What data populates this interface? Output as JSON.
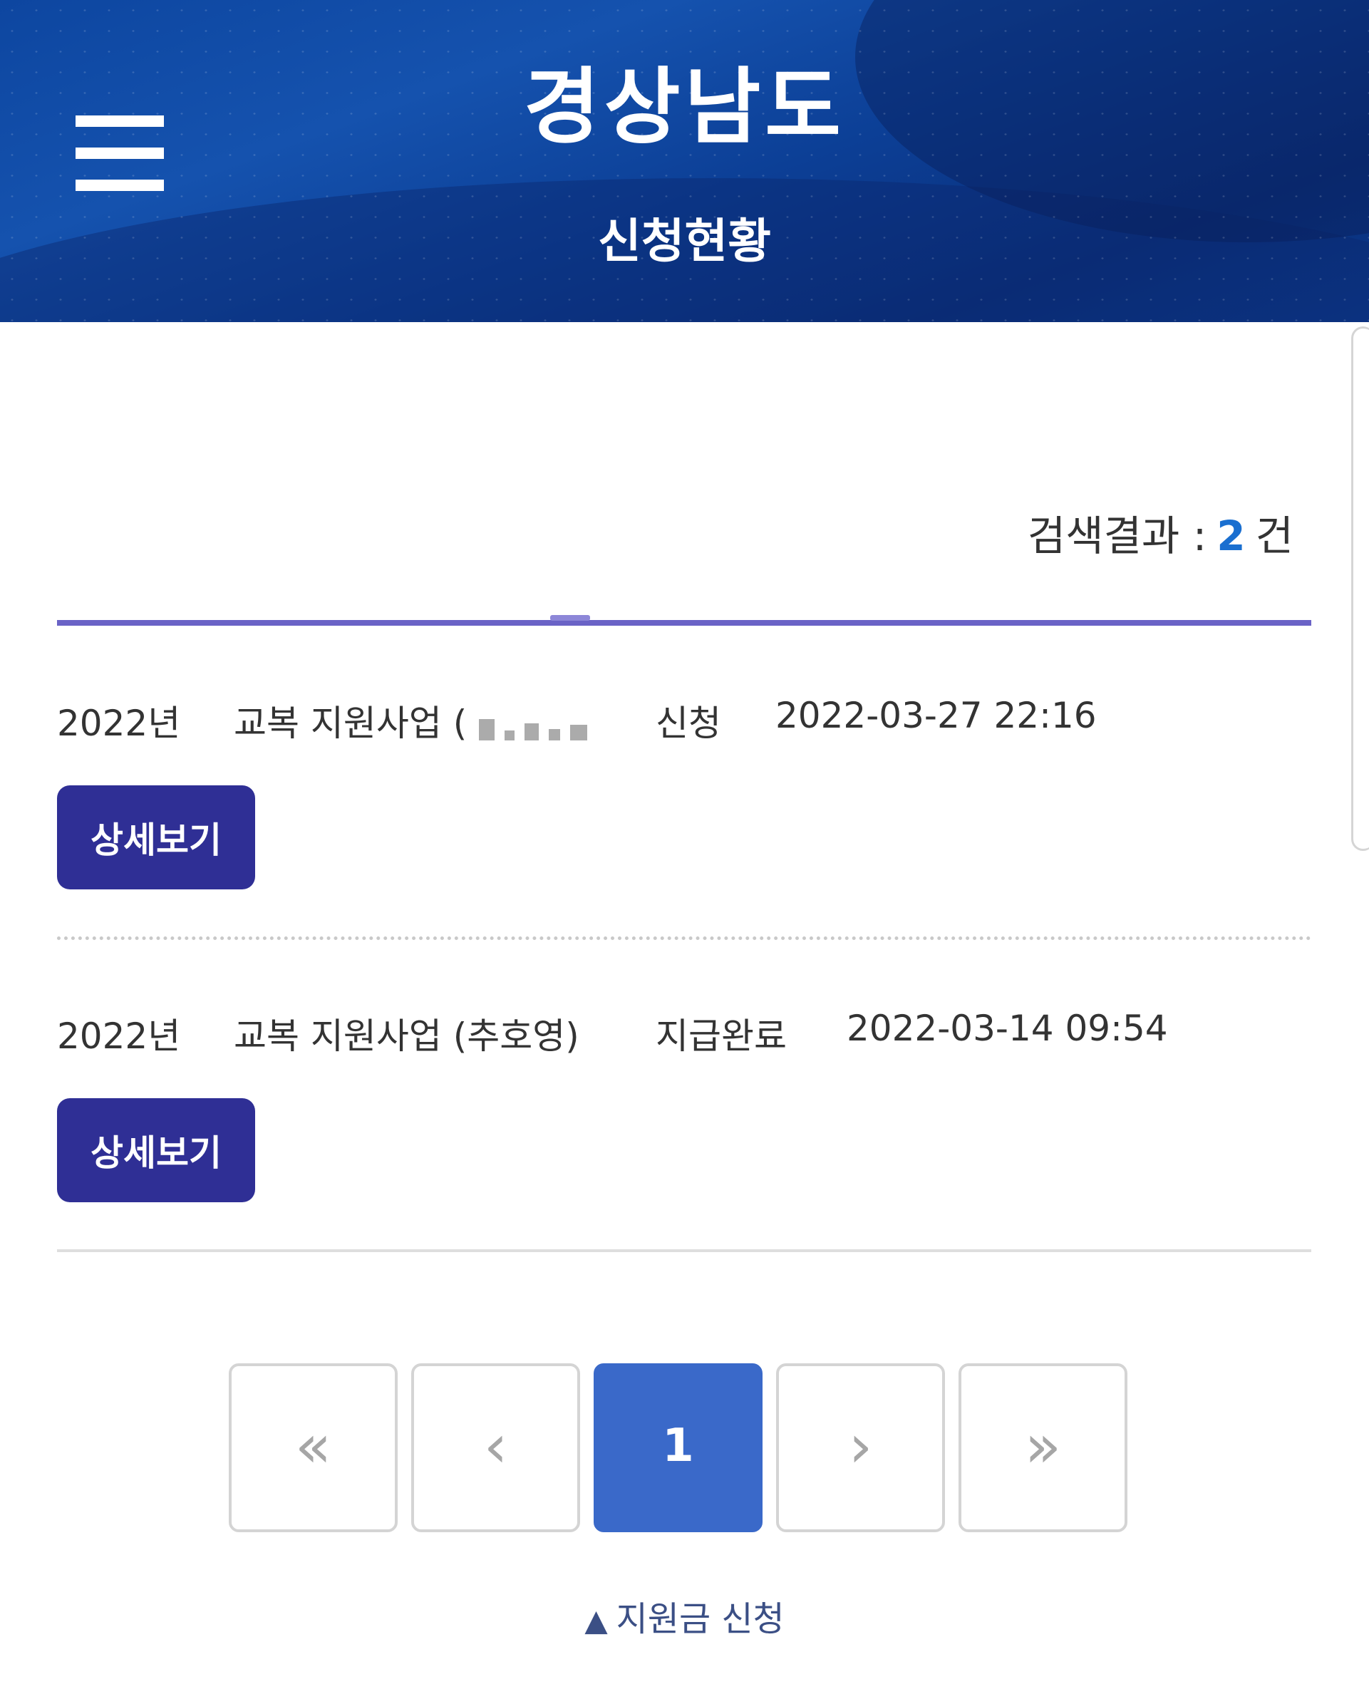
{
  "header": {
    "logo": "경상남도",
    "title": "신청현황",
    "menu_icon": "hamburger-menu-icon"
  },
  "search": {
    "label": "검색결과 :",
    "count": "2",
    "unit": "건"
  },
  "items": [
    {
      "year": "2022년",
      "program": "교복 지원사업 (",
      "status": "신청",
      "datetime": "2022-03-27 22:16",
      "button": "상세보기"
    },
    {
      "year": "2022년",
      "program": "교복 지원사업 (추호영)",
      "status": "지급완료",
      "datetime": "2022-03-14 09:54",
      "button": "상세보기"
    }
  ],
  "pagination": {
    "first": "«",
    "prev": "‹",
    "current": "1",
    "next": "›",
    "last": "»"
  },
  "footer": {
    "arrow": "▲",
    "link": "지원금 신청"
  },
  "colors": {
    "header_bg": "#0d46a0",
    "button_bg": "#2f2f95",
    "accent_rule": "#6a63c6",
    "page_active": "#3a69c9",
    "count_text": "#1a6fd0"
  }
}
